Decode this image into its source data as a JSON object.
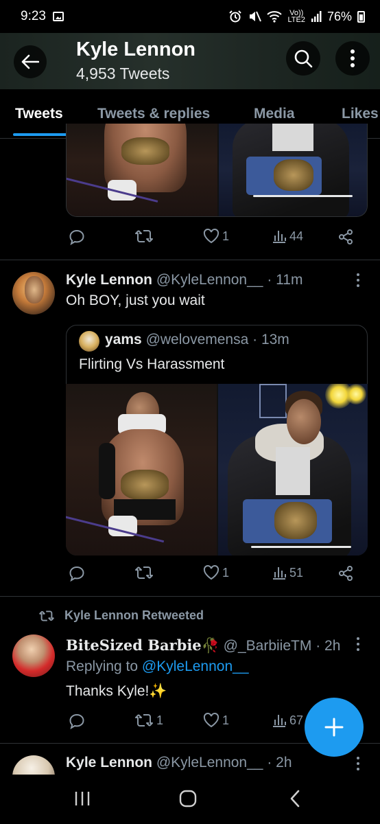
{
  "status_bar": {
    "time": "9:23",
    "lte_label_top": "Vo))",
    "lte_label_bottom": "LTE2",
    "battery": "76%"
  },
  "header": {
    "title": "Kyle Lennon",
    "subtitle": "4,953 Tweets"
  },
  "tabs": [
    {
      "label": "Tweets",
      "active": true
    },
    {
      "label": "Tweets & replies",
      "active": false
    },
    {
      "label": "Media",
      "active": false
    },
    {
      "label": "Likes",
      "active": false
    }
  ],
  "tweets": [
    {
      "actions": {
        "reply": "",
        "retweet": "",
        "like": "1",
        "views": "44"
      }
    },
    {
      "name": "Kyle Lennon",
      "handle": "@KyleLennon__",
      "time": "· 11m",
      "text": "Oh BOY, just you wait",
      "quote": {
        "name": "yams",
        "handle": "@welovemensa",
        "time": "· 13m",
        "text": "Flirting Vs Harassment"
      },
      "actions": {
        "reply": "",
        "retweet": "",
        "like": "1",
        "views": "51"
      }
    },
    {
      "retweet_label": "Kyle Lennon Retweeted",
      "name": "BiteSized Barbie",
      "handle": "@_BarbiieTM",
      "time": "· 2h",
      "replying_prefix": "Replying to",
      "replying_to": "@KyleLennon__",
      "text": "Thanks Kyle!✨",
      "actions": {
        "reply": "",
        "retweet": "1",
        "like": "1",
        "views": "67"
      }
    },
    {
      "name": "Kyle Lennon",
      "handle": "@KyleLennon__",
      "time": "· 2h"
    }
  ],
  "colors": {
    "accent": "#1d9bf0",
    "background": "#000000",
    "text": "#e7e9ea",
    "muted": "#8b98a5",
    "divider": "#2f3336"
  }
}
